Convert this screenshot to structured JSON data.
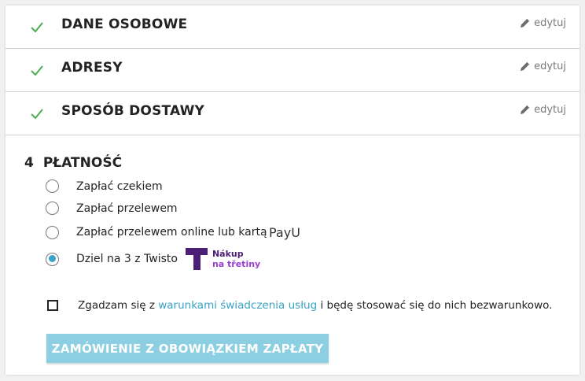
{
  "steps": [
    {
      "title": "DANE OSOBOWE",
      "edit_label": "edytuj"
    },
    {
      "title": "ADRESY",
      "edit_label": "edytuj"
    },
    {
      "title": "SPOSÓB DOSTAWY",
      "edit_label": "edytuj"
    }
  ],
  "payment": {
    "number": "4",
    "title": "PŁATNOŚĆ",
    "options": [
      {
        "label": "Zapłać czekiem",
        "selected": false
      },
      {
        "label": "Zapłać przelewem",
        "selected": false
      },
      {
        "label": "Zapłać przelewem online lub kartą",
        "selected": false,
        "logo": "PayU"
      },
      {
        "label": "Dziel na 3 z Twisto",
        "selected": true,
        "logo_line1": "Nákup",
        "logo_line2": "na třetiny"
      }
    ]
  },
  "terms": {
    "prefix": "Zgadzam się z ",
    "link": "warunkami świadczenia usług",
    "suffix": " i będę stosować się do nich bezwarunkowo.",
    "checked": false
  },
  "submit_label": "ZAMÓWIENIE Z OBOWIĄZKIEM ZAPŁATY",
  "colors": {
    "accent": "#38a3c5",
    "check": "#4caf50",
    "button": "#8ccfe2",
    "twisto": "#4b1f75"
  }
}
